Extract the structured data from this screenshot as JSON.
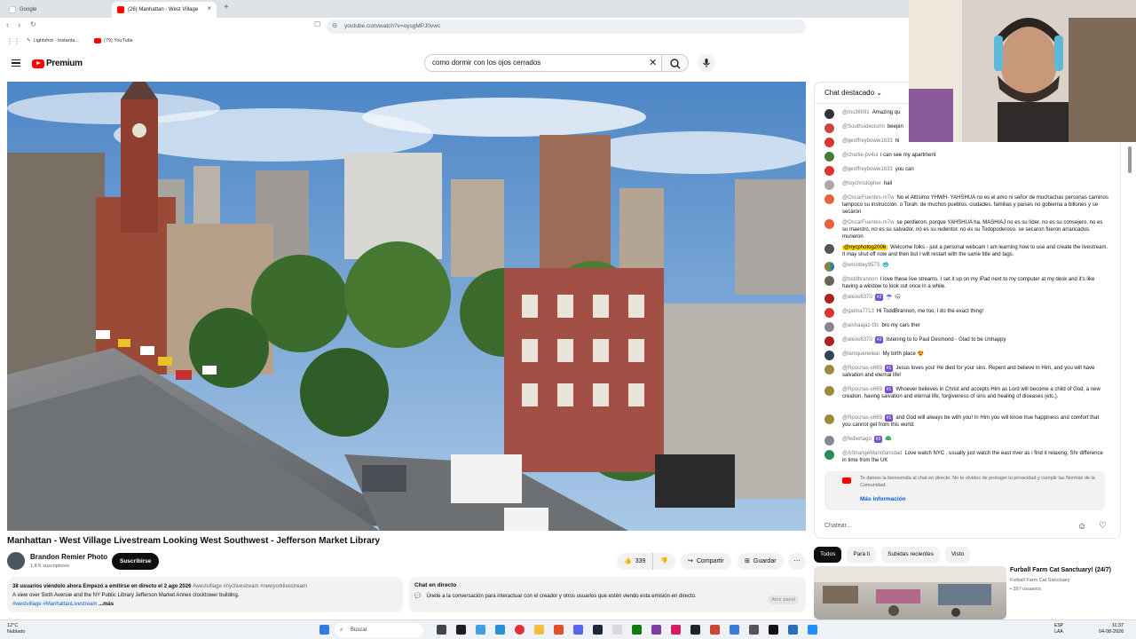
{
  "browser": {
    "tabs": [
      {
        "label": "Google",
        "active": false
      },
      {
        "label": "(26) Manhattan - West Village",
        "active": true
      }
    ],
    "url": "youtube.com/watch?v=oysgMPJ0vwc",
    "bookmarks": [
      "Lightshot - Instanta...",
      "(79) YouTube"
    ]
  },
  "youtube": {
    "logo_text": "Premium",
    "search_query": "como dormir con los ojos cerrados"
  },
  "video": {
    "title": "Manhattan - West Village Livestream Looking West Southwest - Jefferson Market Library",
    "channel": "Brandon Remier Photo",
    "subscribers": "1,8 K suscriptores",
    "subscribe_label": "Suscribirse",
    "likes": "339",
    "share_label": "Compartir",
    "save_label": "Guardar"
  },
  "description": {
    "stats": "38 usuarios viéndolo ahora  Empezó a emitirse en directo el 2 ago 2026",
    "hashtags_inline": "#westvillage #nyclivestream #newyorklivestream",
    "text": "A view over Sixth Avenue and the NY Public Library Jefferson  Market Annex clocktower building.",
    "hashtags": "#westvillage  #ManhattanLivestream",
    "more": "...más"
  },
  "chat_info": {
    "title": "Chat en directo",
    "text": "Únete a la conversación para interactuar con el creador y otros usuarios que estén viendo esta emisión en directo.",
    "open_label": "Abrir panel"
  },
  "chat": {
    "header": "Chat destacado",
    "messages": [
      {
        "author": "@ms36091",
        "text": "Amazing qu"
      },
      {
        "author": "@Southsidestorm",
        "text": "beepin"
      },
      {
        "author": "@geoffreybowie1633",
        "text": "hi"
      },
      {
        "author": "@charlie-pv4ui",
        "text": "i can see my apartment"
      },
      {
        "author": "@geoffreybowie1633",
        "text": "you can"
      },
      {
        "author": "@toychristopher",
        "text": "hail"
      },
      {
        "author": "@OscarFuentes-m7w",
        "text": "No el Altísimo YHWH- YAHSHUA no es el amo ni señor de muchachas personas caminos tampoco su instrucción. o Torah. de muchos pueblos. ciudades. familias y países no gobierna a billones y se secaron"
      },
      {
        "author": "@OscarFuentes-m7w",
        "text": "se perdieron. porque YAHSHUA ha. MASHIAJ no es su líder. no es su consejero. no es su maestro. no es su salvador. no es su redentor. no es su Todopoderoso. se secaron fueron arrancados. murieron"
      },
      {
        "author": "@nycphotog2006",
        "text": "Welcome folks - just a personal webcam I am learning how to use and create the livestream. It may shut off now and then but I will restart with the same title and tags."
      },
      {
        "author": "@eminbey9573",
        "text": "🥶"
      },
      {
        "author": "@toddbrannon",
        "text": "I love these live streams. I set it up on my iPad next to my computer at my desk and it's like having a window to look out once in a while."
      },
      {
        "author": "@alexe8370",
        "text": "☔ 🌧"
      },
      {
        "author": "@gatina7713",
        "text": "Hi ToddBrannon, me too, I do the exact thing!"
      },
      {
        "author": "@aishaajaz-t3c",
        "text": "bro my cars ther"
      },
      {
        "author": "@alexe8370",
        "text": "listening to to Paul Desmond - Glad to be Unhappy"
      },
      {
        "author": "@lamquenelear",
        "text": "My birth place 😍"
      },
      {
        "author": "@Rpocnas-x669",
        "text": "Jesus loves you! He died for your sins. Repent and believe in Him, and you will have salvation and eternal life!"
      },
      {
        "author": "@Rpocnas-x669",
        "text": "Whoever believes in Christ and accepts Him as Lord will become a child of God, a new creation, having salvation and eternal life, forgiveness of sins and healing of diseases (etc.)."
      },
      {
        "author": "@Rpocnas-x669",
        "text": "and God will always be with you! In Him you will know true happiness and comfort that you cannot get from this world."
      },
      {
        "author": "@fedlertago",
        "text": "🦚"
      },
      {
        "author": "@AStrangeMariofansdad",
        "text": "Love watch NYC , usually just watch the east river as i find it relaxing, Shr difference in time from the UK"
      }
    ],
    "welcome_text": "Te damos la bienvenida al chat en directo. No te olvides de proteger tu privacidad y cumplir las Normas de la Comunidad.",
    "welcome_more": "Más información",
    "input_placeholder": "Chatear..."
  },
  "recommendations": {
    "tabs": [
      "Todos",
      "Para ti",
      "Subidas recientes",
      "Visto"
    ],
    "item": {
      "title": "Furball Farm Cat Sanctuary! (24/7)",
      "channel": "Furball Farm Cat Sanctuary",
      "viewers": "• 397 usuarios"
    }
  },
  "taskbar": {
    "weather_temp": "12°C",
    "weather_desc": "Nublado",
    "search_label": "Buscar",
    "lang_top": "ESP",
    "lang_bottom": "LAA",
    "time": "11:37",
    "date": "04-08-2026"
  }
}
